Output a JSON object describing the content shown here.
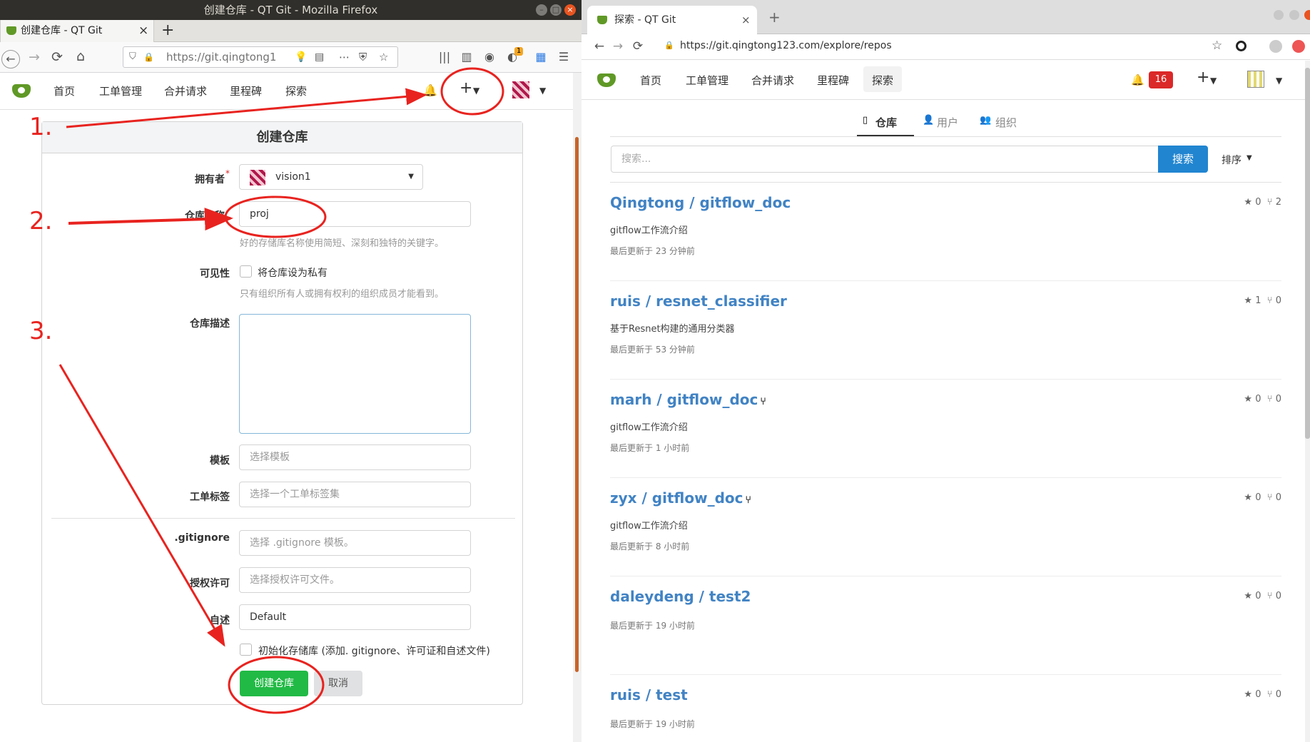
{
  "left_window": {
    "title": "创建仓库 - QT Git - Mozilla Firefox",
    "tab_title": "创建仓库 - QT Git",
    "url": "https://git.qingtong1",
    "badge": "1",
    "menu": {
      "home": "首页",
      "issues": "工单管理",
      "pulls": "合并请求",
      "milestones": "里程碑",
      "explore": "探索",
      "plus": "+"
    },
    "form": {
      "header": "创建仓库",
      "owner_label": "拥有者",
      "owner_value": "vision1",
      "repo_name_label": "仓库名称",
      "repo_name_value": "proj",
      "repo_name_help": "好的存储库名称使用简短、深刻和独特的关键字。",
      "visibility_label": "可见性",
      "private_label": "将仓库设为私有",
      "private_help": "只有组织所有人或拥有权利的组织成员才能看到。",
      "description_label": "仓库描述",
      "template_label": "模板",
      "template_placeholder": "选择模板",
      "issue_labels_label": "工单标签",
      "issue_labels_placeholder": "选择一个工单标签集",
      "gitignore_label": ".gitignore",
      "gitignore_placeholder": "选择 .gitignore 模板。",
      "license_label": "授权许可",
      "license_placeholder": "选择授权许可文件。",
      "readme_label": "自述",
      "readme_value": "Default",
      "auto_init_label": "初始化存储库 (添加. gitignore、许可证和自述文件)",
      "create_button": "创建仓库",
      "cancel_button": "取消"
    }
  },
  "right_window": {
    "tab_title": "探索 - QT Git",
    "url": "https://git.qingtong123.com/explore/repos",
    "notification_count": "16",
    "menu": {
      "home": "首页",
      "issues": "工单管理",
      "pulls": "合并请求",
      "milestones": "里程碑",
      "explore": "探索",
      "plus": "+"
    },
    "tabs": {
      "repos": "仓库",
      "users": "用户",
      "orgs": "组织"
    },
    "search_placeholder": "搜索...",
    "search_button": "搜索",
    "sort_label": "排序",
    "repos": [
      {
        "name": "Qingtong / gitflow_doc",
        "desc": "gitflow工作流介绍",
        "updated": "最后更新于 23 分钟前",
        "stars": "0",
        "forks": "2",
        "forked": false
      },
      {
        "name": "ruis / resnet_classifier",
        "desc": "基于Resnet构建的通用分类器",
        "updated": "最后更新于 53 分钟前",
        "stars": "1",
        "forks": "0",
        "forked": false
      },
      {
        "name": "marh / gitflow_doc",
        "desc": "gitflow工作流介绍",
        "updated": "最后更新于 1 小时前",
        "stars": "0",
        "forks": "0",
        "forked": true
      },
      {
        "name": "zyx / gitflow_doc",
        "desc": "gitflow工作流介绍",
        "updated": "最后更新于 8 小时前",
        "stars": "0",
        "forks": "0",
        "forked": true
      },
      {
        "name": "daleydeng / test2",
        "desc": "",
        "updated": "最后更新于 19 小时前",
        "stars": "0",
        "forks": "0",
        "forked": false
      },
      {
        "name": "ruis / test",
        "desc": "",
        "updated": "最后更新于 19 小时前",
        "stars": "0",
        "forks": "0",
        "forked": false
      }
    ]
  },
  "annotations": {
    "step1": "1.",
    "step2": "2.",
    "step3": "3.",
    "color": "#e8231f"
  },
  "colors": {
    "brand": "#609926",
    "primary": "#2185d0",
    "success": "#21ba45",
    "danger": "#db2828",
    "link": "#4183c4"
  }
}
